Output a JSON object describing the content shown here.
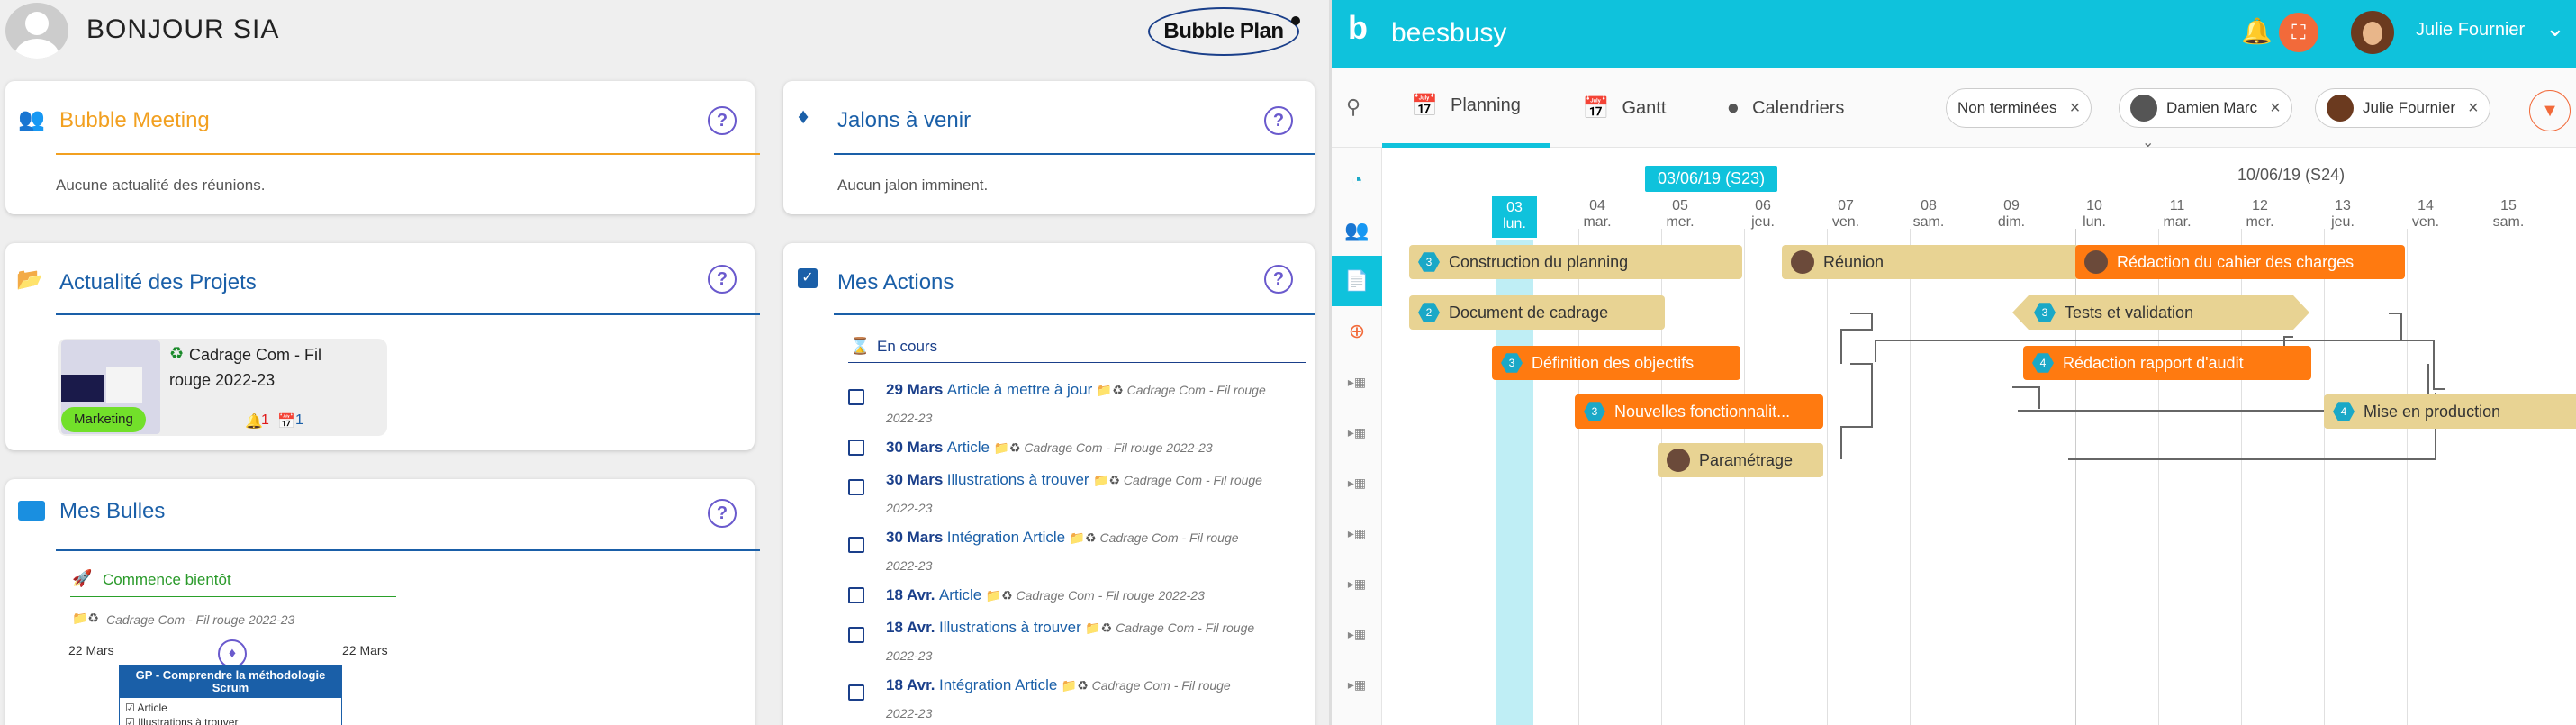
{
  "left": {
    "greeting": "BONJOUR  SIA",
    "logo_text": "Bubble Plan",
    "meeting": {
      "title": "Bubble Meeting",
      "empty": "Aucune actualité des réunions."
    },
    "jalons": {
      "title": "Jalons à venir",
      "empty": "Aucun jalon imminent."
    },
    "projets": {
      "title": "Actualité des Projets",
      "project_name_1": "Cadrage Com - Fil",
      "project_name_2": "rouge 2022-23",
      "tag": "Marketing",
      "alerts": "1",
      "events": "1"
    },
    "actions": {
      "title": "Mes Actions",
      "section": "En cours",
      "items": [
        {
          "date": "29 Mars",
          "text": "Article à mettre à jour",
          "proj_a": "Cadrage Com - Fil rouge",
          "proj_b": "2022-23"
        },
        {
          "date": "30 Mars",
          "text": "Article",
          "proj_a": "Cadrage Com - Fil rouge 2022-23",
          "proj_b": ""
        },
        {
          "date": "30 Mars",
          "text": "Illustrations à trouver",
          "proj_a": "Cadrage Com - Fil rouge",
          "proj_b": "2022-23"
        },
        {
          "date": "30 Mars",
          "text": "Intégration Article",
          "proj_a": "Cadrage Com - Fil rouge",
          "proj_b": "2022-23"
        },
        {
          "date": "18 Avr.",
          "text": "Article",
          "proj_a": "Cadrage Com - Fil rouge 2022-23",
          "proj_b": ""
        },
        {
          "date": "18 Avr.",
          "text": "Illustrations à trouver",
          "proj_a": "Cadrage Com - Fil rouge",
          "proj_b": "2022-23"
        },
        {
          "date": "18 Avr.",
          "text": "Intégration Article",
          "proj_a": "Cadrage Com - Fil rouge",
          "proj_b": "2022-23"
        }
      ]
    },
    "bulles": {
      "title": "Mes Bulles",
      "section": "Commence bientôt",
      "project": "Cadrage Com - Fil rouge 2022-23",
      "date_start": "22 Mars",
      "date_end": "22 Mars",
      "card_title": "GP - Comprendre la méthodologie Scrum",
      "card_items": [
        "Article",
        "Illustrations à trouver"
      ]
    }
  },
  "right": {
    "app_name": "beesbusy",
    "user_name": "Julie Fournier",
    "tabs": [
      {
        "label": "Planning"
      },
      {
        "label": "Gantt"
      },
      {
        "label": "Calendriers"
      }
    ],
    "chips": [
      {
        "label": "Non terminées"
      },
      {
        "label": "Damien Marc"
      },
      {
        "label": "Julie Fournier"
      }
    ],
    "weeks": [
      "03/06/19 (S23)",
      "10/06/19 (S24)"
    ],
    "days": [
      {
        "n": "03",
        "d": "lun."
      },
      {
        "n": "04",
        "d": "mar."
      },
      {
        "n": "05",
        "d": "mer."
      },
      {
        "n": "06",
        "d": "jeu."
      },
      {
        "n": "07",
        "d": "ven."
      },
      {
        "n": "08",
        "d": "sam."
      },
      {
        "n": "09",
        "d": "dim."
      },
      {
        "n": "10",
        "d": "lun."
      },
      {
        "n": "11",
        "d": "mar."
      },
      {
        "n": "12",
        "d": "mer."
      },
      {
        "n": "13",
        "d": "jeu."
      },
      {
        "n": "14",
        "d": "ven."
      },
      {
        "n": "15",
        "d": "sam."
      }
    ],
    "tasks": [
      {
        "label": "Construction du planning",
        "badge": "3"
      },
      {
        "label": "Réunion",
        "badge": ""
      },
      {
        "label": "Rédaction du cahier des charges",
        "badge": ""
      },
      {
        "label": "Document de cadrage",
        "badge": "2"
      },
      {
        "label": "Tests et validation",
        "badge": "3"
      },
      {
        "label": "Définition des objectifs",
        "badge": "3"
      },
      {
        "label": "Rédaction rapport d'audit",
        "badge": "4"
      },
      {
        "label": "Nouvelles fonctionnalit...",
        "badge": "3"
      },
      {
        "label": "Mise en production",
        "badge": "4"
      },
      {
        "label": "Paramétrage",
        "badge": ""
      }
    ]
  }
}
